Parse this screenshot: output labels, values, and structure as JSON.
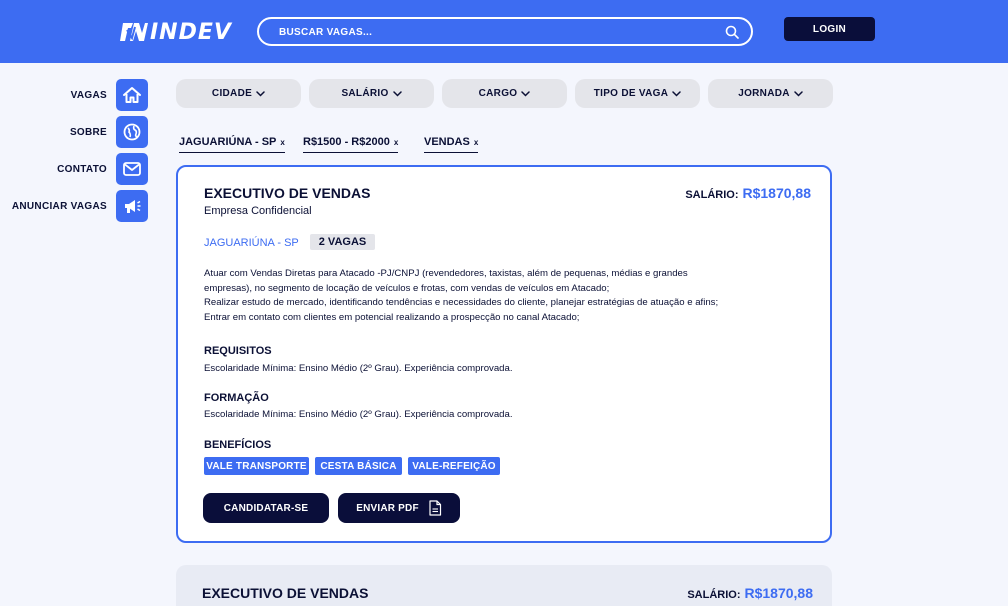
{
  "brand": {
    "logo_text": "INDEV"
  },
  "search": {
    "placeholder": "BUSCAR VAGAS..."
  },
  "header": {
    "login_label": "LOGIN"
  },
  "sidebar": {
    "items": [
      {
        "label": "VAGAS",
        "icon": "home-icon"
      },
      {
        "label": "SOBRE",
        "icon": "globe-icon"
      },
      {
        "label": "CONTATO",
        "icon": "mail-icon"
      },
      {
        "label": "ANUNCIAR VAGAS",
        "icon": "megaphone-icon"
      }
    ]
  },
  "filters": [
    {
      "label": "CIDADE"
    },
    {
      "label": "SALÁRIO"
    },
    {
      "label": "CARGO"
    },
    {
      "label": "TIPO DE VAGA"
    },
    {
      "label": "JORNADA"
    }
  ],
  "active_filters": [
    {
      "label": "JAGUARIÚNA - SP",
      "remove": "x"
    },
    {
      "label": "R$1500 - R$2000",
      "remove": "x"
    },
    {
      "label": "VENDAS",
      "remove": "x"
    }
  ],
  "jobs": [
    {
      "title": "EXECUTIVO DE VENDAS",
      "company": "Empresa Confidencial",
      "salary_label": "SALÁRIO:",
      "salary_value": "R$1870,88",
      "location": "JAGUARIÚNA - SP",
      "openings": "2 VAGAS",
      "description": [
        "Atuar com Vendas Diretas para Atacado -PJ/CNPJ (revendedores, taxistas, além de pequenas, médias e grandes",
        "empresas), no segmento de locação de veículos e frotas, com vendas de veículos em Atacado;",
        "Realizar estudo de mercado, identificando tendências e necessidades do cliente, planejar estratégias de atuação e afins;",
        "Entrar em contato com clientes em potencial realizando a prospecção no canal Atacado;"
      ],
      "requirements_title": "REQUISITOS",
      "requirements_text": "Escolaridade Mínima: Ensino Médio (2º Grau). Experiência comprovada.",
      "education_title": "FORMAÇÃO",
      "education_text": "Escolaridade Mínima: Ensino Médio (2º Grau). Experiência comprovada.",
      "benefits_title": "BENEFÍCIOS",
      "benefits": [
        "VALE TRANSPORTE",
        "CESTA BÁSICA",
        "VALE-REFEIÇÃO"
      ],
      "apply_label": "CANDIDATAR-SE",
      "pdf_label": "ENVIAR PDF"
    },
    {
      "title": "EXECUTIVO DE VENDAS",
      "salary_label": "SALÁRIO:",
      "salary_value": "R$1870,88"
    }
  ],
  "colors": {
    "primary": "#3d6cf2",
    "dark": "#0a0e3a",
    "background": "#f4f6fd",
    "chip_bg": "#e4e5ea"
  }
}
